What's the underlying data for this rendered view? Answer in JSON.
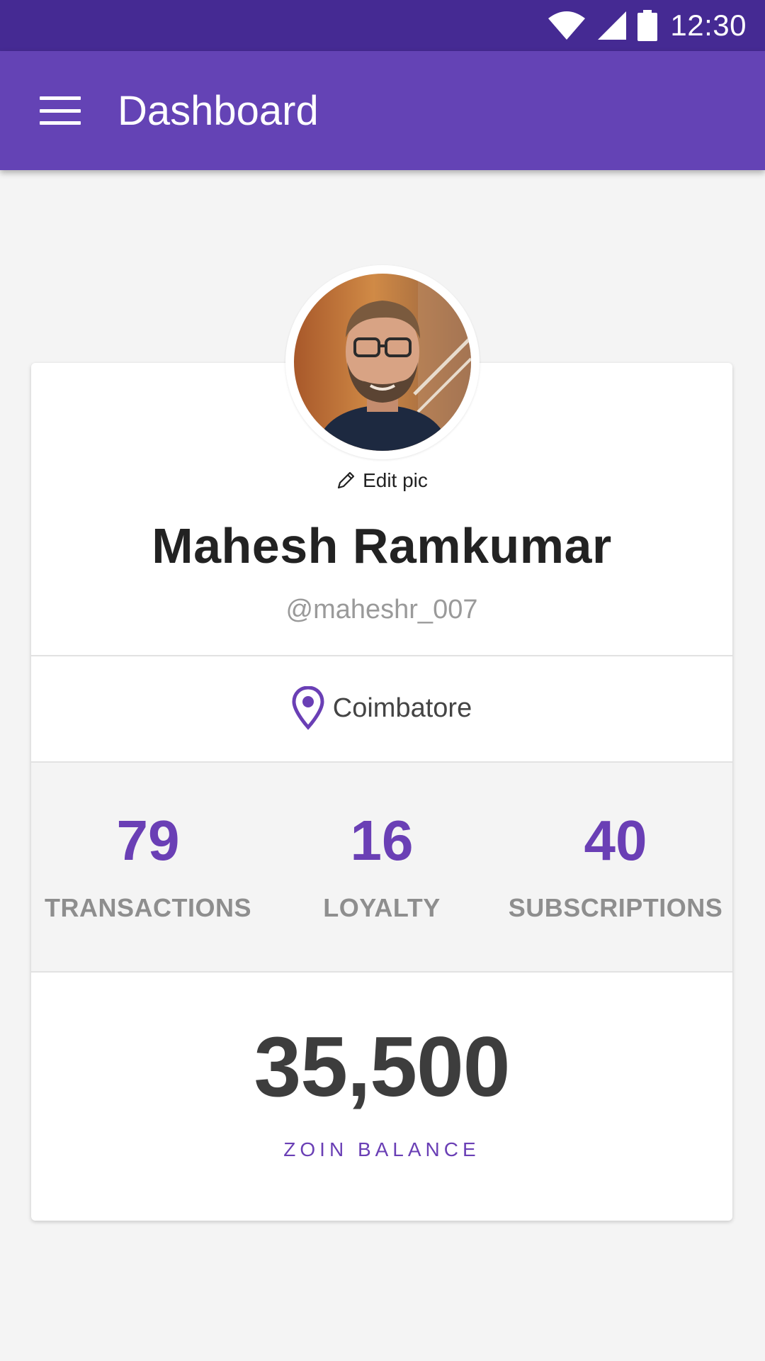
{
  "status_bar": {
    "time": "12:30",
    "icons": [
      "wifi-icon",
      "signal-icon",
      "battery-icon"
    ]
  },
  "app_bar": {
    "title": "Dashboard",
    "menu_icon": "hamburger-menu-icon"
  },
  "profile": {
    "edit_pic_label": "Edit pic",
    "name": "Mahesh Ramkumar",
    "handle": "@maheshr_007",
    "location": "Coimbatore"
  },
  "stats": [
    {
      "value": "79",
      "label": "TRANSACTIONS"
    },
    {
      "value": "16",
      "label": "LOYALTY"
    },
    {
      "value": "40",
      "label": "SUBSCRIPTIONS"
    }
  ],
  "balance": {
    "value": "35,500",
    "label": "ZOIN BALANCE"
  },
  "colors": {
    "status_bar": "#452a93",
    "app_bar": "#6443b5",
    "accent": "#6a3fb5",
    "background": "#f4f4f4"
  }
}
